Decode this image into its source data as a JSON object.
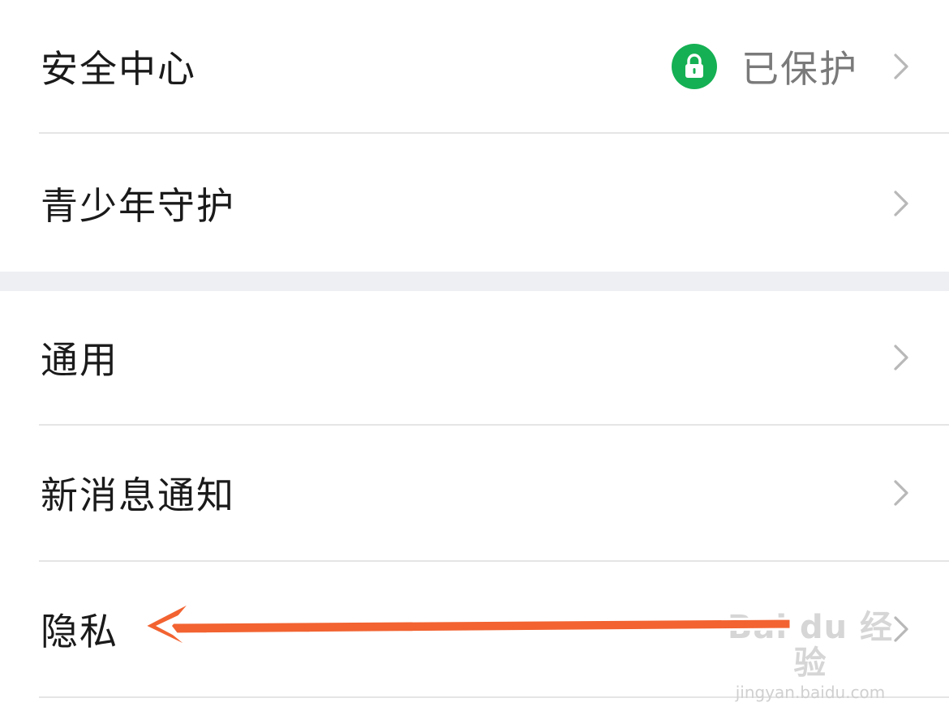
{
  "settings": {
    "items": [
      {
        "label": "安全中心",
        "status": "已保护",
        "status_icon": "lock-icon"
      },
      {
        "label": "青少年守护"
      },
      {
        "label": "通用"
      },
      {
        "label": "新消息通知"
      },
      {
        "label": "隐私"
      }
    ]
  },
  "annotation": {
    "type": "arrow",
    "color": "#f26331",
    "points_to": "隐私"
  },
  "watermark": {
    "main": "Bai du 经验",
    "sub": "jingyan.baidu.com"
  },
  "colors": {
    "badge_green": "#15b053",
    "divider": "#e5e5e5",
    "section_gap": "#eeeff3",
    "chevron": "#b8b8b8",
    "status_text": "#7a7a7a"
  }
}
